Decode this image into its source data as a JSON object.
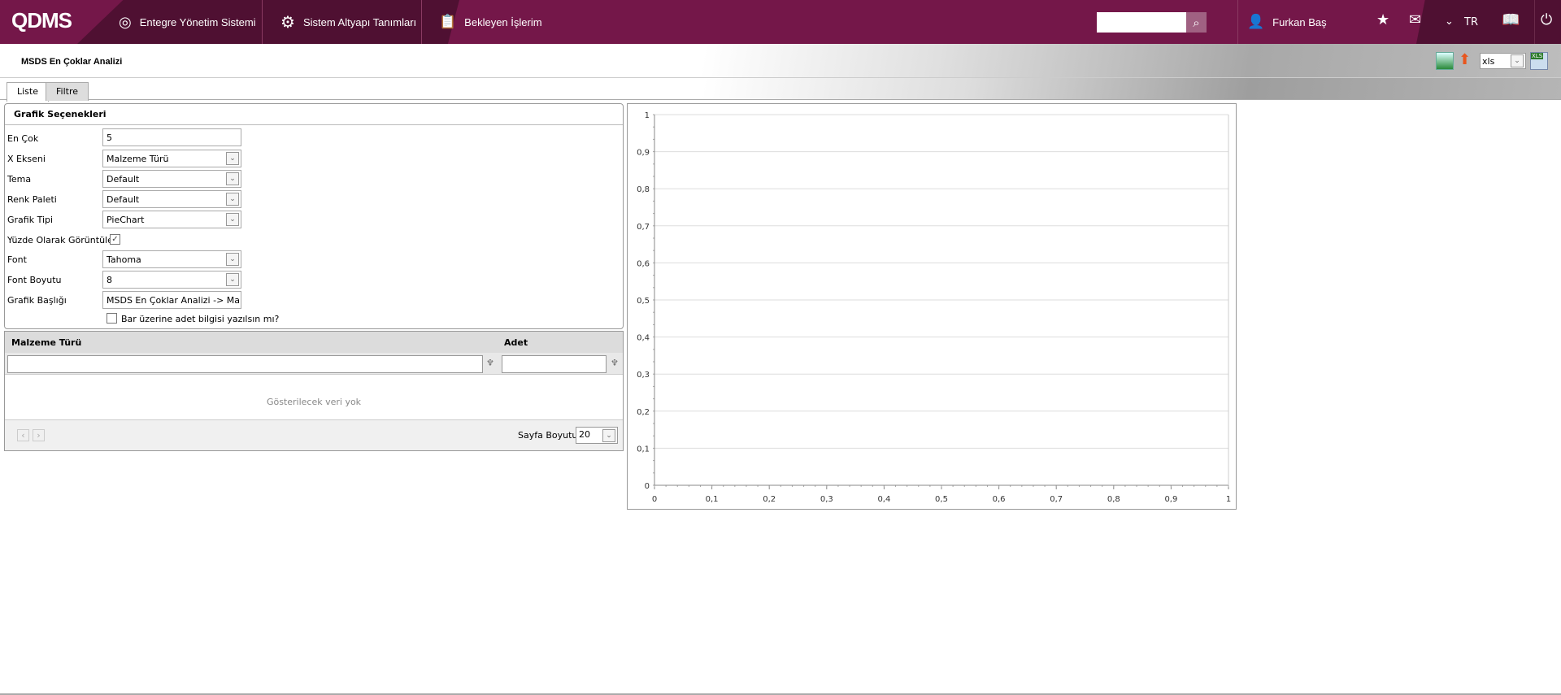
{
  "header": {
    "logo": "QDMS",
    "nav": [
      "Entegre Yönetim Sistemi",
      "Sistem Altyapı Tanımları",
      "Bekleyen İşlerim"
    ],
    "search_placeholder": "",
    "user": "Furkan Baş",
    "language": "TR"
  },
  "page": {
    "title": "MSDS En Çoklar Analizi",
    "export_format": "xls",
    "tabs": [
      "Liste",
      "Filtre"
    ]
  },
  "options": {
    "title": "Grafik Seçenekleri",
    "fields": [
      {
        "label": "En Çok",
        "value": "5"
      },
      {
        "label": "X Ekseni",
        "value": "Malzeme Türü"
      },
      {
        "label": "Tema",
        "value": "Default"
      },
      {
        "label": "Renk Paleti",
        "value": "Default"
      },
      {
        "label": "Grafik Tipi",
        "value": "PieChart"
      },
      {
        "label": "Yüzde Olarak Görüntüle",
        "checked": true
      },
      {
        "label": "Font",
        "value": "Tahoma"
      },
      {
        "label": "Font Boyutu",
        "value": "8"
      },
      {
        "label": "Grafik Başlığı",
        "value": "MSDS En Çoklar Analizi -> Malzeme Türü"
      }
    ],
    "bar_label": "Bar üzerine adet bilgisi yazılsın mı?",
    "bar_checked": false
  },
  "grid": {
    "columns": [
      "Malzeme Türü",
      "Adet"
    ],
    "empty_text": "Gösterilecek veri yok",
    "page_size_label": "Sayfa Boyutu:",
    "page_size": "20"
  },
  "chart_data": {
    "type": "line",
    "title": "",
    "xlabel": "",
    "ylabel": "",
    "series": [],
    "xlim": [
      0,
      1
    ],
    "ylim": [
      0,
      1
    ],
    "xticks": [
      "0",
      "0,1",
      "0,2",
      "0,3",
      "0,4",
      "0,5",
      "0,6",
      "0,7",
      "0,8",
      "0,9",
      "1"
    ],
    "yticks": [
      "0",
      "0,1",
      "0,2",
      "0,3",
      "0,4",
      "0,5",
      "0,6",
      "0,7",
      "0,8",
      "0,9",
      "1"
    ],
    "grid": true
  }
}
